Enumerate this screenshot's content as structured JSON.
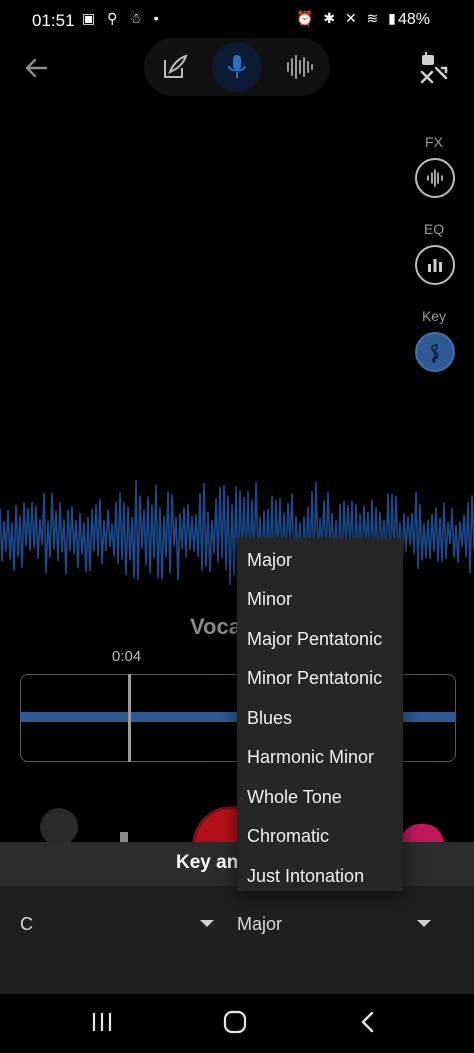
{
  "status_bar": {
    "time": "01:51",
    "left_icons": "▣ ⚲ ☃ •",
    "right_icons": "⏰ ✱ ✕ ≋ ▮",
    "battery": "48%"
  },
  "toolbar": {
    "back_icon": "arrow-left-icon",
    "modes": [
      "lyrics-edit-icon",
      "microphone-icon",
      "waveform-icon"
    ],
    "active_mode": "microphone-icon",
    "swap_icon": "shuffle-icon"
  },
  "side_controls": {
    "fx_label": "FX",
    "eq_label": "EQ",
    "key_label": "Key"
  },
  "track": {
    "title": "Voca",
    "timecode": "0:04"
  },
  "sheet": {
    "title": "Key and",
    "key_value": "C",
    "scale_value": "Major"
  },
  "scale_menu": {
    "options": [
      "Major",
      "Minor",
      "Major Pentatonic",
      "Minor Pentatonic",
      "Blues",
      "Harmonic Minor",
      "Whole Tone",
      "Chromatic",
      "Just Intonation"
    ]
  },
  "colors": {
    "accent": "#2f5a94",
    "waveform": "#1d4a8a",
    "record": "#b3121d"
  }
}
